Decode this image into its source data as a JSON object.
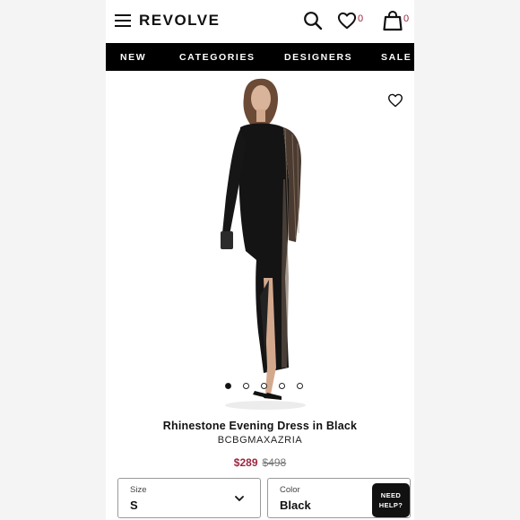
{
  "header": {
    "logo": "REVOLVE",
    "favorites_count": "0",
    "bag_count": "0"
  },
  "nav": {
    "items": [
      "NEW",
      "CATEGORIES",
      "DESIGNERS",
      "SALE"
    ]
  },
  "product": {
    "title": "Rhinestone Evening Dress in Black",
    "brand": "BCBGMAXAZRIA",
    "price_sale": "$289",
    "price_original": "$498",
    "image_dots_total": 5,
    "image_dot_active_index": 0
  },
  "selectors": {
    "size": {
      "label": "Size",
      "value": "S"
    },
    "color": {
      "label": "Color",
      "value": "Black"
    }
  },
  "help": {
    "line1": "NEED",
    "line2": "HELP?"
  },
  "icons": [
    "menu-icon",
    "search-icon",
    "heart-icon",
    "shopping-bag-icon",
    "chevron-down-icon"
  ],
  "colors": {
    "accent": "#a0253f",
    "nav_background": "#000000"
  }
}
